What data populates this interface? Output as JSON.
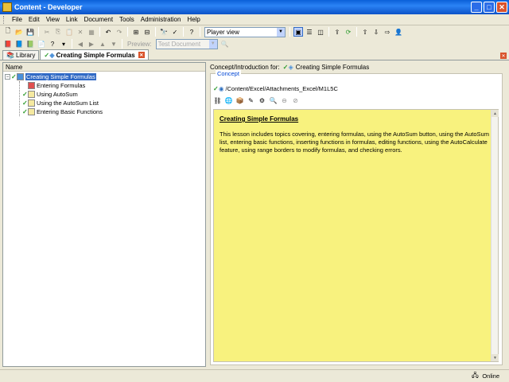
{
  "window": {
    "title": "Content - Developer"
  },
  "menu": [
    "File",
    "Edit",
    "View",
    "Link",
    "Document",
    "Tools",
    "Administration",
    "Help"
  ],
  "toolbar1": {
    "view_combo": "Player view"
  },
  "toolbar2": {
    "preview_label": "Preview:",
    "preview_combo": "Test Document"
  },
  "tabs": [
    {
      "label": "Library"
    },
    {
      "label": "Creating Simple Formulas"
    }
  ],
  "tree": {
    "column_header": "Name",
    "root": "Creating Simple Formulas",
    "children": [
      "Entering Formulas",
      "Using AutoSum",
      "Using the AutoSum List",
      "Entering Basic Functions"
    ]
  },
  "concept": {
    "header_label": "Concept/Introduction for:",
    "header_title": "Creating Simple Formulas",
    "group_title": "Concept",
    "path": "/Content/Excel/Attachments_Excel/M1L5C",
    "doc_title": "Creating Simple Formulas",
    "doc_body": "This lesson includes topics covering, entering formulas, using the AutoSum button, using the AutoSum list, entering basic functions, inserting functions in formulas, editing functions, using the AutoCalculate feature, using range borders to modify formulas, and checking errors."
  },
  "status": {
    "text": "Online"
  },
  "colors": {
    "title_bar": "#0a5fd8",
    "editor_bg": "#f8f27e",
    "selection": "#316ac5",
    "check": "#2d9b2d"
  }
}
